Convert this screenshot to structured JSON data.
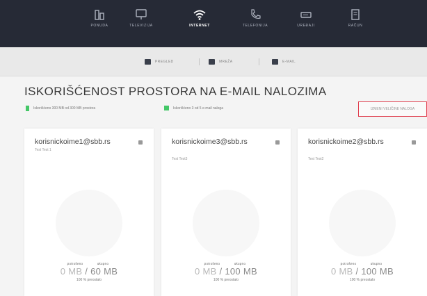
{
  "nav": {
    "items": [
      {
        "label": "PONUDA",
        "icon": "building-icon",
        "active": false
      },
      {
        "label": "TELEVIZIJA",
        "icon": "tv-icon",
        "active": false
      },
      {
        "label": "INTERNET",
        "icon": "wifi-icon",
        "active": true
      },
      {
        "label": "TELEFONIJA",
        "icon": "phone-icon",
        "active": false
      },
      {
        "label": "UREĐAJI",
        "icon": "router-icon",
        "active": false
      },
      {
        "label": "RAČUN",
        "icon": "bill-icon",
        "active": false
      }
    ]
  },
  "subnav": {
    "items": [
      {
        "label": "PREGLED",
        "icon": "square-icon"
      },
      {
        "label": "MREŽA",
        "icon": "square-icon"
      },
      {
        "label": "E-MAIL",
        "icon": "square-icon"
      }
    ]
  },
  "page": {
    "title": "ISKORIŠĆENOST PROSTORA NA E-MAIL NALOZIMA",
    "legend_used": "Iskorišćeno 300 MB od 300 MB prostora",
    "legend_accounts": "Iskorišćeno 3 od 5 e-mail naloga",
    "edit_button": "IZMENI VELIČINE NALOGA"
  },
  "colors": {
    "accent_green": "#44c767",
    "nav_bg": "#262a36",
    "edit_border": "#e04050"
  },
  "cards": [
    {
      "email": "korisnickoime1@sbb.rs",
      "name": "Test Test 1",
      "used_label": "potrošeno",
      "total_label": "ukupno",
      "used": "0 MB",
      "total": "60 MB",
      "percent": "100 % preostalo"
    },
    {
      "email": "korisnickoime3@sbb.rs",
      "name": "Test Test3",
      "used_label": "potrošeno",
      "total_label": "ukupno",
      "used": "0 MB",
      "total": "100 MB",
      "percent": "100 % preostalo"
    },
    {
      "email": "korisnickoime2@sbb.rs",
      "name": "Test Test2",
      "used_label": "potrošeno",
      "total_label": "ukupno",
      "used": "0 MB",
      "total": "100 MB",
      "percent": "100 % preostalo"
    }
  ]
}
